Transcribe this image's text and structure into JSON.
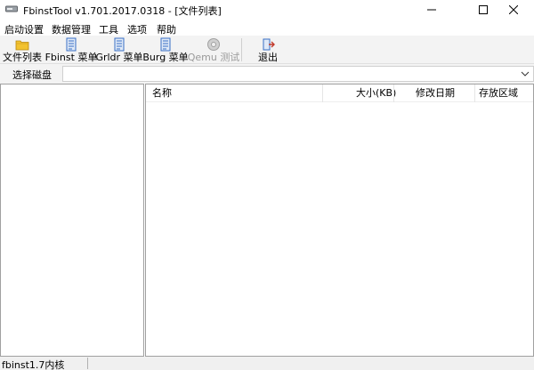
{
  "window": {
    "title": "FbinstTool v1.701.2017.0318 - [文件列表]"
  },
  "menu": {
    "items": [
      "启动设置",
      "数据管理",
      "工具",
      "选项",
      "帮助"
    ]
  },
  "toolbar": {
    "buttons": [
      {
        "label": "文件列表",
        "icon": "folder-icon",
        "enabled": true
      },
      {
        "label": "Fbinst 菜单",
        "icon": "menu-doc-icon",
        "enabled": true
      },
      {
        "label": "Grldr 菜单",
        "icon": "menu-doc-icon",
        "enabled": true
      },
      {
        "label": "Burg 菜单",
        "icon": "menu-doc-icon",
        "enabled": true
      },
      {
        "label": "Qemu 测试",
        "icon": "qemu-icon",
        "enabled": false
      },
      {
        "label": "退出",
        "icon": "exit-door-icon",
        "enabled": true
      }
    ]
  },
  "disk_selector": {
    "label": "选择磁盘",
    "value": ""
  },
  "file_list": {
    "columns": [
      "名称",
      "大小(KB)",
      "修改日期",
      "存放区域"
    ],
    "rows": []
  },
  "status": {
    "text": "fbinst1.7内核"
  },
  "colors": {
    "toolbar_bg": "#f3f3f3",
    "border": "#a0a0a0",
    "folder_yellow": "#f2c230",
    "doc_blue": "#3a6fc4"
  }
}
